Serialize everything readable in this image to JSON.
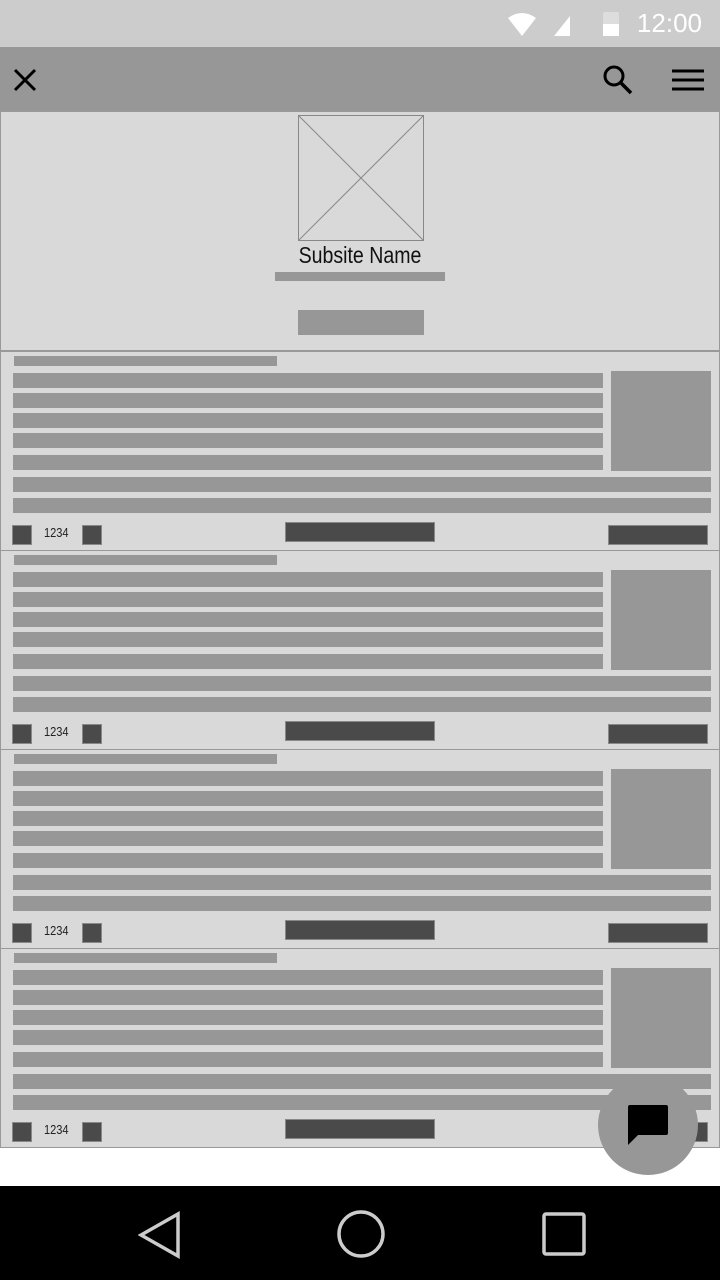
{
  "status_bar": {
    "time": "12:00"
  },
  "app_bar": {
    "close_icon": "close-icon",
    "search_icon": "search-icon",
    "menu_icon": "menu-icon"
  },
  "hero": {
    "subsite_name": "Subsite Name"
  },
  "cards": [
    {
      "count": "1234"
    },
    {
      "count": "1234"
    },
    {
      "count": "1234"
    },
    {
      "count": "1234"
    }
  ],
  "fab": {
    "icon": "chat-icon"
  }
}
